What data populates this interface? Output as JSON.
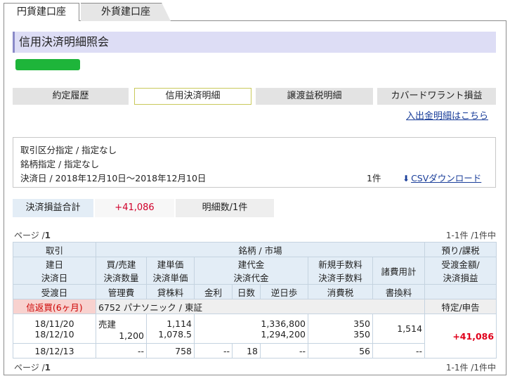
{
  "tabs": {
    "yen": "円貨建口座",
    "foreign": "外貨建口座"
  },
  "page_title": "信用決済明細照会",
  "subtabs": [
    "約定履歴",
    "信用決済明細",
    "譲渡益税明細",
    "カバードワラント損益"
  ],
  "links": {
    "nyushukkin": "入出金明細はこちら",
    "csv": "CSVダウンロード"
  },
  "criteria": {
    "line1": "取引区分指定 / 指定なし",
    "line2": "銘柄指定 /  指定なし",
    "line3": "決済日 / 2018年12月10日～2018年12月10日",
    "count": "1件"
  },
  "summary": {
    "label": "決済損益合計",
    "value": "+41,086",
    "count": "明細数/1件"
  },
  "pagination": {
    "page_label": "ページ /",
    "page_number": "1",
    "range": "1-1件 /1件中"
  },
  "table": {
    "header1": {
      "c1": "取引",
      "c2": "銘柄 / 市場",
      "c3": "預り/課税"
    },
    "header2": {
      "a": [
        "建日",
        "決済日"
      ],
      "b": [
        "買/売建",
        "決済数量"
      ],
      "c": [
        "建単価",
        "決済単価"
      ],
      "d": [
        "建代金",
        "決済代金"
      ],
      "e": [
        "新規手数料",
        "決済手数料"
      ],
      "f": "諸費用計",
      "g": [
        "受渡金額/",
        "決済損益"
      ]
    },
    "header3": [
      "受渡日",
      "管理費",
      "貸株料",
      "金利",
      "日数",
      "逆日歩",
      "消費税",
      "書換料"
    ],
    "row": {
      "label": "信返買(6ヶ月)",
      "stock": "6752 パナソニック / 東証",
      "account": "特定/申告",
      "open_date": "18/11/20",
      "settle_date": "18/12/10",
      "side": "売建",
      "qty": "1,200",
      "open_price": "1,114",
      "settle_price": "1,078.5",
      "open_amount": "1,336,800",
      "settle_amount": "1,294,200",
      "new_fee": "350",
      "settle_fee": "350",
      "total_cost": "1,514",
      "pnl": "+41,086",
      "delivery_date": "18/12/13",
      "mgmt_fee": "--",
      "lending_fee": "758",
      "interest": "--",
      "days": "18",
      "reverse_fee": "--",
      "tax": "56",
      "rewrite_fee": "--"
    }
  }
}
